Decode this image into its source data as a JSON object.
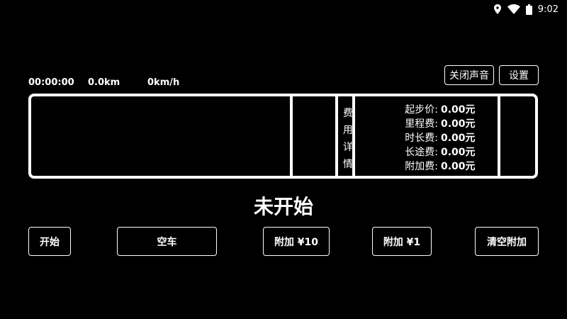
{
  "status_bar": {
    "time": "9:02",
    "icons": [
      "location-icon",
      "wifi-icon",
      "battery-icon"
    ]
  },
  "stats": {
    "elapsed": "00:00:00",
    "distance": "0.0km",
    "speed": "0km/h"
  },
  "top_buttons": {
    "mute_label": "关闭声音",
    "settings_label": "设置"
  },
  "fee_panel": {
    "vertical_label": [
      "费",
      "用",
      "详",
      "情"
    ],
    "rows": [
      {
        "label": "起步价:",
        "value": "0.00元"
      },
      {
        "label": "里程费:",
        "value": "0.00元"
      },
      {
        "label": "时长费:",
        "value": "0.00元"
      },
      {
        "label": "长途费:",
        "value": "0.00元"
      },
      {
        "label": "附加费:",
        "value": "0.00元"
      }
    ]
  },
  "status_text": "未开始",
  "bottom_buttons": {
    "start": "开始",
    "vacant": "空车",
    "extra10": "附加 ¥10",
    "extra1": "附加 ¥1",
    "clear": "清空附加"
  }
}
